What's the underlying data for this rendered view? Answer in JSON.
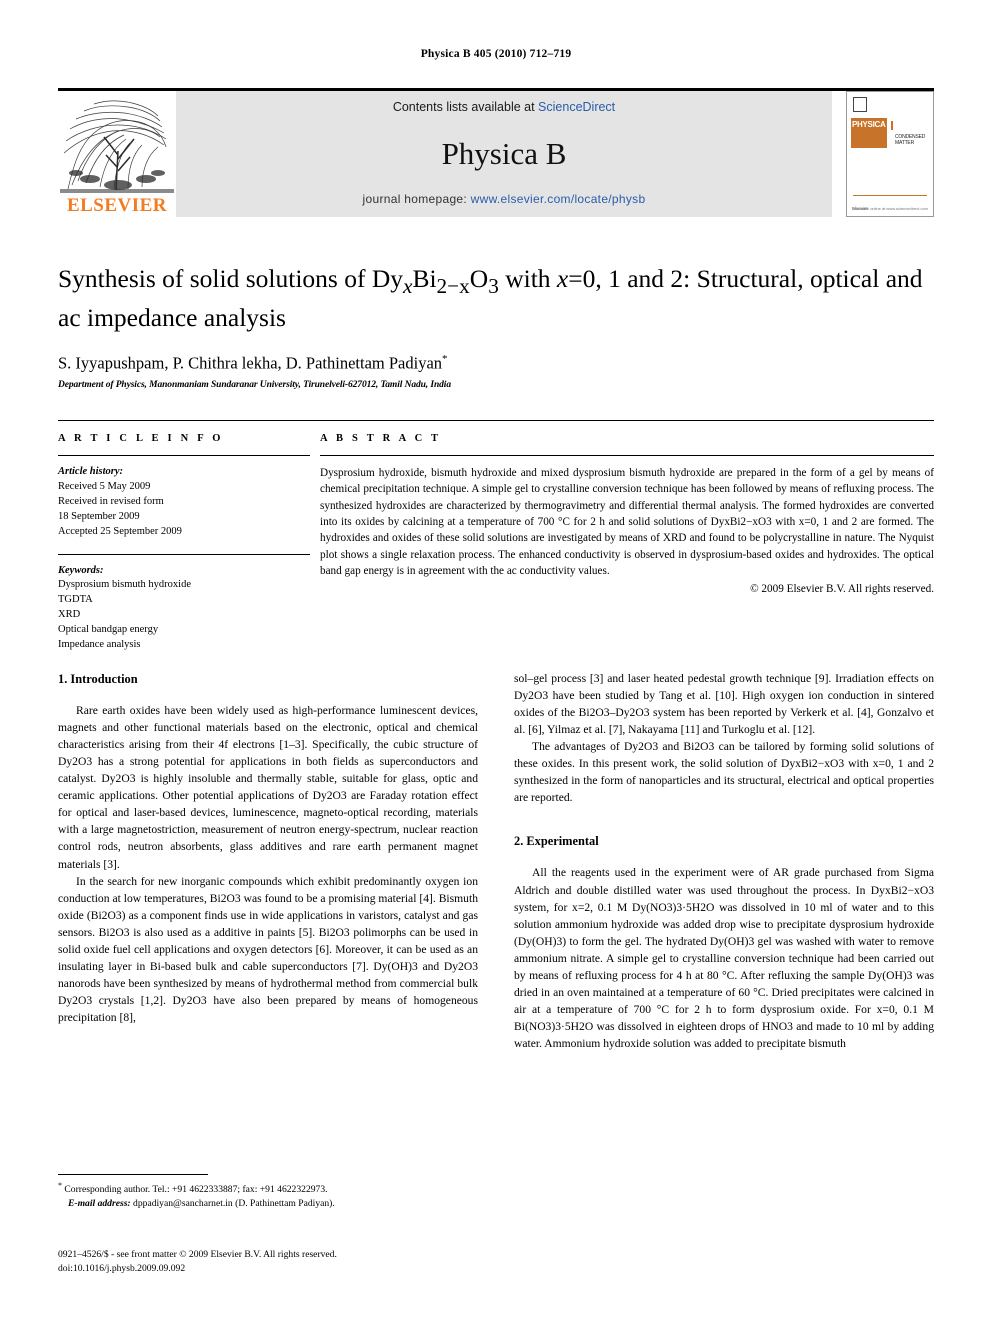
{
  "running_head": "Physica B 405 (2010) 712–719",
  "masthead": {
    "contents_prefix": "Contents lists available at ",
    "contents_link": "ScienceDirect",
    "journal_title": "Physica B",
    "homepage_prefix": "journal homepage: ",
    "homepage_url": "www.elsevier.com/locate/physb",
    "publisher_name": "ELSEVIER",
    "cover": {
      "brand": "PHYSICA",
      "subtitle": "CONDENSED MATTER",
      "footer_left": "Elsevier",
      "footer_right": "available online at www.sciencedirect.com"
    }
  },
  "article": {
    "title_part1": "Synthesis of solid solutions of Dy",
    "title_sub1": "x",
    "title_part2": "Bi",
    "title_sub2": "2−x",
    "title_part3": "O",
    "title_sub3": "3",
    "title_part4": " with ",
    "title_italic_x": "x",
    "title_part5": "=0, 1 and 2: Structural, optical and ac impedance analysis",
    "authors": "S. Iyyapushpam, P. Chithra lekha, D. Pathinettam Padiyan",
    "corresponding_marker": "*",
    "affiliation": "Department of Physics, Manonmaniam Sundaranar University, Tirunelveli-627012, Tamil Nadu, India"
  },
  "article_info": {
    "heading": "A R T I C L E   I N F O",
    "history_label": "Article history:",
    "history": [
      "Received 5 May 2009",
      "Received in revised form",
      "18 September 2009",
      "Accepted 25 September 2009"
    ],
    "keywords_label": "Keywords:",
    "keywords": [
      "Dysprosium bismuth hydroxide",
      "TGDTA",
      "XRD",
      "Optical bandgap energy",
      "Impedance analysis"
    ]
  },
  "abstract": {
    "heading": "A B S T R A C T",
    "text": "Dysprosium hydroxide, bismuth hydroxide and mixed dysprosium bismuth hydroxide are prepared in the form of a gel by means of chemical precipitation technique. A simple gel to crystalline conversion technique has been followed by means of refluxing process. The synthesized hydroxides are characterized by thermogravimetry and differential thermal analysis. The formed hydroxides are converted into its oxides by calcining at a temperature of 700 °C for 2 h and solid solutions of DyxBi2−xO3 with x=0, 1 and 2 are formed. The hydroxides and oxides of these solid solutions are investigated by means of XRD and found to be polycrystalline in nature. The Nyquist plot shows a single relaxation process. The enhanced conductivity is observed in dysprosium-based oxides and hydroxides. The optical band gap energy is in agreement with the ac conductivity values.",
    "copyright": "© 2009 Elsevier B.V. All rights reserved."
  },
  "sections": {
    "introduction_heading": "1.  Introduction",
    "experimental_heading": "2.  Experimental",
    "intro_p1": "Rare earth oxides have been widely used as high-performance luminescent devices, magnets and other functional materials based on the electronic, optical and chemical characteristics arising from their 4f electrons [1–3]. Specifically, the cubic structure of Dy2O3 has a strong potential for applications in both fields as superconductors and catalyst. Dy2O3 is highly insoluble and thermally stable, suitable for glass, optic and ceramic applications. Other potential applications of Dy2O3 are Faraday rotation effect for optical and laser-based devices, luminescence, magneto-optical recording, materials with a large magnetostriction, measurement of neutron energy-spectrum, nuclear reaction control rods, neutron absorbents, glass additives and rare earth permanent magnet materials [3].",
    "intro_p2": "In the search for new inorganic compounds which exhibit predominantly oxygen ion conduction at low temperatures, Bi2O3 was found to be a promising material [4]. Bismuth oxide (Bi2O3) as a component finds use in wide applications in varistors, catalyst and gas sensors. Bi2O3 is also used as a additive in paints [5]. Bi2O3 polimorphs can be used in solid oxide fuel cell applications and oxygen detectors [6]. Moreover, it can be used as an insulating layer in Bi-based bulk and cable superconductors [7]. Dy(OH)3 and Dy2O3 nanorods have been synthesized by means of hydrothermal method from commercial bulk Dy2O3 crystals [1,2]. Dy2O3 have also been prepared by means of homogeneous precipitation [8],",
    "intro_p3": "sol–gel process [3] and laser heated pedestal growth technique [9]. Irradiation effects on Dy2O3 have been studied by Tang et al. [10]. High oxygen ion conduction in sintered oxides of the Bi2O3–Dy2O3 system has been reported by Verkerk et al. [4], Gonzalvo et al. [6], Yilmaz et al. [7], Nakayama [11] and Turkoglu et al. [12].",
    "intro_p4": "The advantages of Dy2O3 and Bi2O3 can be tailored by forming solid solutions of these oxides. In this present work, the solid solution of DyxBi2−xO3 with x=0, 1 and 2 synthesized in the form of nanoparticles and its structural, electrical and optical properties are reported.",
    "exp_p1": "All the reagents used in the experiment were of AR grade purchased from Sigma Aldrich and double distilled water was used throughout the process. In DyxBi2−xO3 system, for x=2, 0.1 M Dy(NO3)3·5H2O was dissolved in 10 ml of water and to this solution ammonium hydroxide was added drop wise to precipitate dysprosium hydroxide (Dy(OH)3) to form the gel. The hydrated Dy(OH)3 gel was washed with water to remove ammonium nitrate. A simple gel to crystalline conversion technique had been carried out by means of refluxing process for 4 h at 80 °C. After refluxing the sample Dy(OH)3 was dried in an oven maintained at a temperature of 60 °C. Dried precipitates were calcined in air at a temperature of 700 °C for 2 h to form dysprosium oxide. For x=0, 0.1 M Bi(NO3)3·5H2O was dissolved in eighteen drops of HNO3 and made to 10 ml by adding water. Ammonium hydroxide solution was added to precipitate bismuth"
  },
  "footnote": {
    "marker": "*",
    "corresponding": "Corresponding author. Tel.: +91 4622333887; fax: +91 4622322973.",
    "email_label": "E-mail address:",
    "email": "dppadiyan@sancharnet.in (D. Pathinettam Padiyan)."
  },
  "imprint": {
    "line1": "0921–4526/$ - see front matter © 2009 Elsevier B.V. All rights reserved.",
    "line2": "doi:10.1016/j.physb.2009.09.092"
  },
  "colors": {
    "link": "#2a5caa",
    "reference": "#1a3a8f",
    "elsevier_orange": "#F47B20",
    "band_gray": "#e4e4e4"
  }
}
